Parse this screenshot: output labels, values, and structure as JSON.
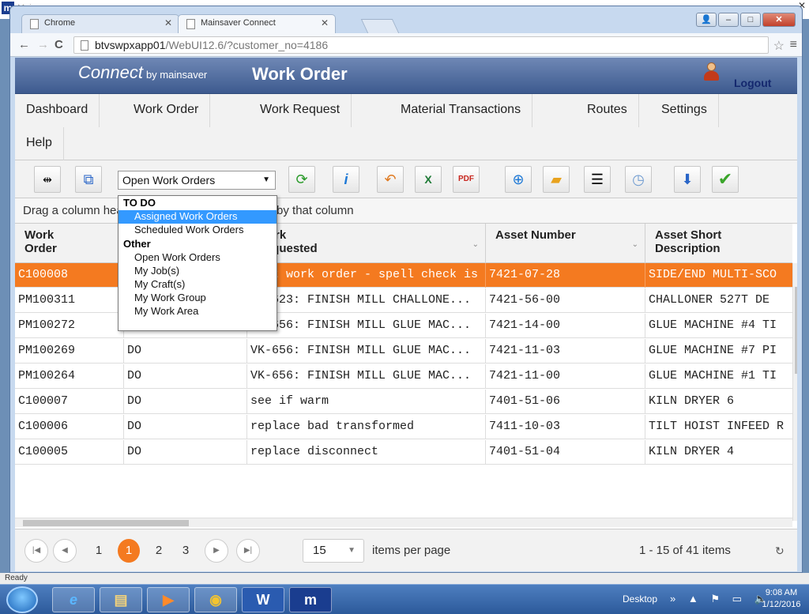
{
  "outer_window": {
    "title": "Mainsaver"
  },
  "browser": {
    "tabs": [
      {
        "label": "Chrome"
      },
      {
        "label": "Mainsaver Connect"
      }
    ],
    "url_host": "btvswpxapp01",
    "url_path": "/WebUI12.6/?customer_no=4186"
  },
  "header": {
    "brand": "Connect",
    "brand_by": "by mainsaver",
    "title": "Work Order",
    "logout": "Logout"
  },
  "menu": {
    "items": [
      "Dashboard",
      "Work Order",
      "Work Request",
      "Material Transactions",
      "Routes",
      "Settings",
      "Help"
    ]
  },
  "toolbar": {
    "view_select": "Open Work Orders"
  },
  "groupbar": {
    "text": "Drag a column header and drop it here to group by that column"
  },
  "dropdown": {
    "group_todo": "TO DO",
    "group_other": "Other",
    "items": [
      "Assigned Work Orders",
      "Scheduled Work Orders",
      "Open Work Orders",
      "My Job(s)",
      "My Craft(s)",
      "My Work Group",
      "My Work Area"
    ]
  },
  "grid": {
    "headers": [
      "Work\nOrder",
      "",
      "Work\nRequested",
      "Asset Number",
      "Asset Short\nDescription"
    ],
    "h_work_order_1": "Work",
    "h_work_order_2": "Order",
    "h_requested_1": "Work",
    "h_requested_2": "Requested",
    "h_asset_number": "Asset Number",
    "h_asset_desc_1": "Asset Short",
    "h_asset_desc_2": "Description",
    "rows": [
      {
        "wo": "C100008",
        "st": "",
        "req": "Test work order - spell check is b...",
        "asset": "7421-07-28",
        "desc": "SIDE/END MULTI-SCO"
      },
      {
        "wo": "PM100311",
        "st": "DO",
        "req": "VK-623: FINISH MILL CHALLONE...",
        "asset": "7421-56-00",
        "desc": "CHALLONER 527T DE"
      },
      {
        "wo": "PM100272",
        "st": "DO",
        "req": "VK-656: FINISH MILL GLUE MAC...",
        "asset": "7421-14-00",
        "desc": "GLUE MACHINE #4 TI"
      },
      {
        "wo": "PM100269",
        "st": "DO",
        "req": "VK-656: FINISH MILL GLUE MAC...",
        "asset": "7421-11-03",
        "desc": "GLUE MACHINE #7 PI"
      },
      {
        "wo": "PM100264",
        "st": "DO",
        "req": "VK-656: FINISH MILL GLUE MAC...",
        "asset": "7421-11-00",
        "desc": "GLUE MACHINE #1 TI"
      },
      {
        "wo": "C100007",
        "st": "DO",
        "req": "see if warm",
        "asset": "7401-51-06",
        "desc": "KILN DRYER 6"
      },
      {
        "wo": "C100006",
        "st": "DO",
        "req": "replace bad transformed",
        "asset": "7411-10-03",
        "desc": "TILT HOIST INFEED R"
      },
      {
        "wo": "C100005",
        "st": "DO",
        "req": "replace disconnect",
        "asset": "7401-51-04",
        "desc": "KILN DRYER 4"
      }
    ]
  },
  "pager": {
    "pages": [
      "1",
      "1",
      "2",
      "3"
    ],
    "page_size": "15",
    "per_page_label": "items per page",
    "info": "1 - 15 of 41 items"
  },
  "status": {
    "text": "Ready"
  },
  "taskbar": {
    "desktop": "Desktop",
    "time": "9:08 AM",
    "date": "1/12/2016"
  },
  "colors": {
    "accent": "#f47a20",
    "header": "#3d5a8f",
    "highlight": "#3399ff"
  }
}
